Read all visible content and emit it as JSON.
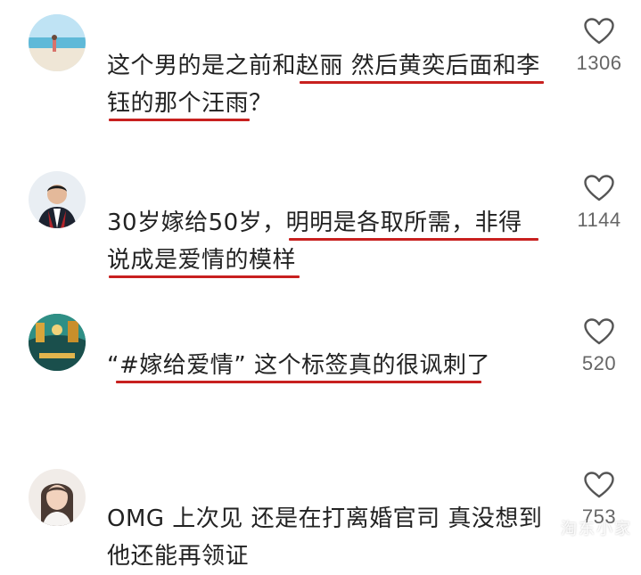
{
  "comments": [
    {
      "lines": [
        "这个男的是之前和赵丽 然后黄奕后面和李",
        "钰的那个汪雨？"
      ],
      "likes": "1306",
      "avatar_icon": "beach-avatar-icon"
    },
    {
      "lines": [
        "30岁嫁给50岁，明明是各取所需，非得",
        "说成是爱情的模样"
      ],
      "likes": "1144",
      "avatar_icon": "man-avatar-icon"
    },
    {
      "lines": [
        "“#嫁给爱情” 这个标签真的很讽刺了"
      ],
      "likes": "520",
      "avatar_icon": "scene-avatar-icon"
    },
    {
      "lines": [
        "OMG 上次见 还是在打离婚官司 真没想到",
        "他还能再领证"
      ],
      "likes": "753",
      "avatar_icon": "woman-avatar-icon"
    }
  ],
  "like_icon": "heart-outline-icon",
  "watermark": "淘东小家",
  "colors": {
    "underline": "#c8201f",
    "count": "#666666",
    "text": "#222222"
  }
}
